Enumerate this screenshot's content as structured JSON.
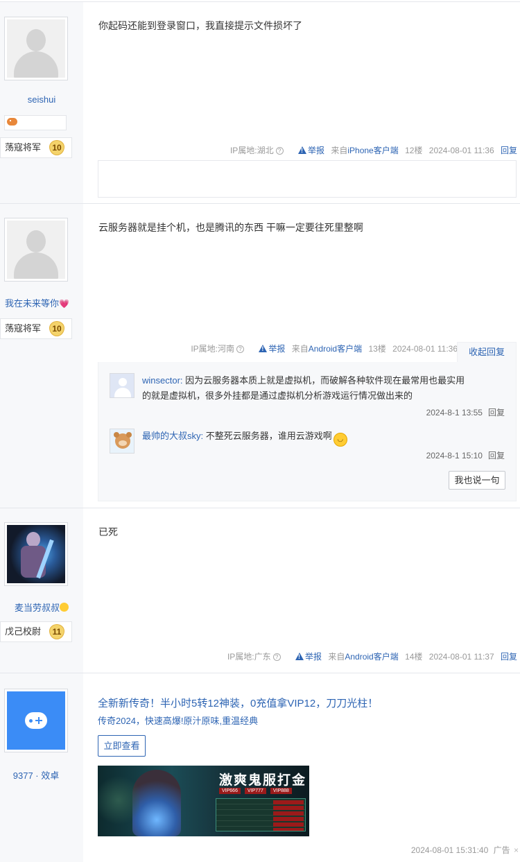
{
  "posts": [
    {
      "username": "seishui",
      "rank": "荡寇将军",
      "level": "10",
      "content": "你起码还能到登录窗口，我直接提示文件损坏了",
      "ip": "IP属地:湖北",
      "report": "举报",
      "from_prefix": "来自",
      "client": "iPhone客户端",
      "floor": "12楼",
      "time": "2024-08-01 11:36",
      "reply": "回复"
    },
    {
      "username": "我在未来等你",
      "rank": "荡寇将军",
      "level": "10",
      "content": "云服务器就是挂个机，也是腾讯的东西 干嘛一定要往死里整啊",
      "ip": "IP属地:河南",
      "report": "举报",
      "from_prefix": "来自",
      "client": "Android客户端",
      "floor": "13楼",
      "time": "2024-08-01 11:36",
      "collapse": "收起回复",
      "replies": [
        {
          "user": "winsector:",
          "text": "因为云服务器本质上就是虚拟机，而破解各种软件现在最常用也最实用",
          "text2": "的就是虚拟机，很多外挂都是通过虚拟机分析游戏运行情况做出来的",
          "time": "2024-8-1 13:55",
          "reply": "回复"
        },
        {
          "user": "最帅的大叔sky:",
          "text": "不整死云服务器，谁用云游戏啊",
          "time": "2024-8-1 15:10",
          "reply": "回复"
        }
      ],
      "say_button": "我也说一句"
    },
    {
      "username": "麦当劳叔叔",
      "rank": "戊己校尉",
      "level": "11",
      "content": "已死",
      "ip": "IP属地:广东",
      "report": "举报",
      "from_prefix": "来自",
      "client": "Android客户端",
      "floor": "14楼",
      "time": "2024-08-01 11:37",
      "reply": "回复"
    }
  ],
  "ad": {
    "advertiser": "9377 · 效卓",
    "title": "全新新传奇！半小时5转12神装，0充值拿VIP12，刀刀光柱！",
    "subtitle": "传奇2024，快速高爆!原汁原味,重温经典",
    "button": "立即查看",
    "banner_title": "激爽鬼服打金",
    "banner_vips": [
      "VIP666",
      "VIP777",
      "VIP888"
    ],
    "time": "2024-08-01 15:31:40",
    "label": "广告"
  },
  "colors": {
    "link": "#2d64b3",
    "sidebar": "#f7f8fa",
    "border": "#e4e6eb"
  }
}
